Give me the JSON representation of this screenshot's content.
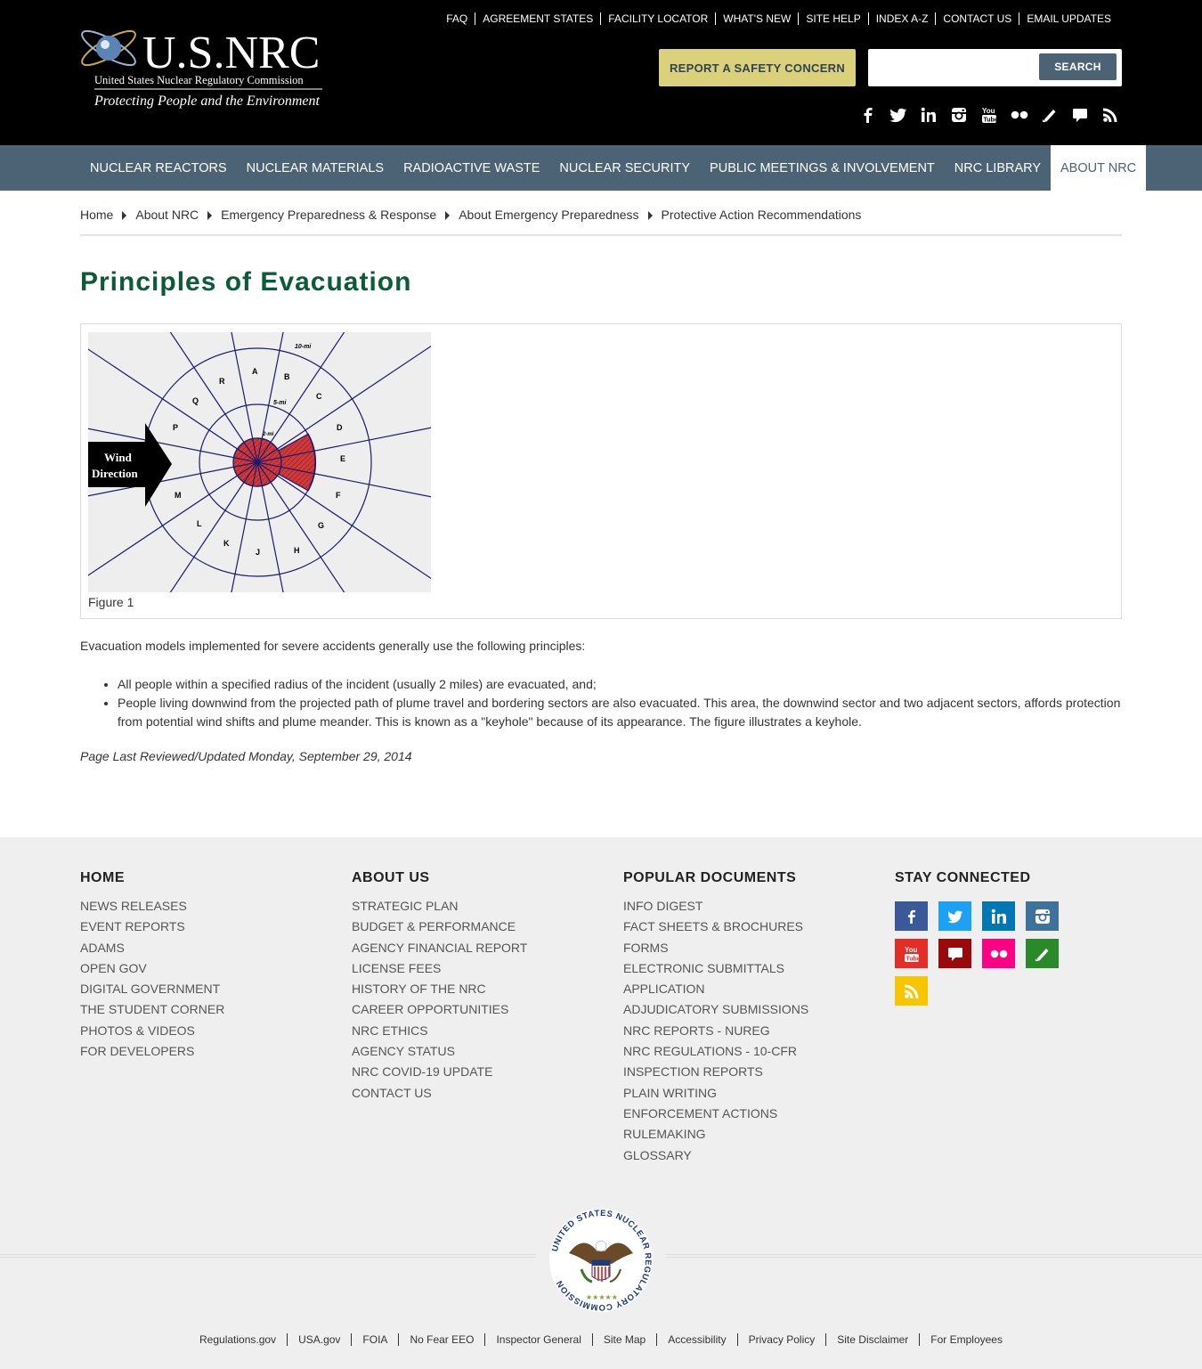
{
  "header": {
    "logo_title": "U.S.NRC",
    "logo_subtitle": "United States Nuclear Regulatory Commission",
    "logo_tagline": "Protecting People and the Environment",
    "utility_links": [
      "FAQ",
      "AGREEMENT STATES",
      "FACILITY LOCATOR",
      "WHAT'S NEW",
      "SITE HELP",
      "INDEX A-Z",
      "CONTACT US",
      "EMAIL UPDATES"
    ],
    "safety_button": "REPORT A SAFETY CONCERN",
    "search_placeholder": "",
    "search_button": "SEARCH",
    "social_icons": [
      "facebook-icon",
      "twitter-icon",
      "linkedin-icon",
      "instagram-icon",
      "youtube-icon",
      "flickr-icon",
      "blog-icon",
      "comment-icon",
      "rss-icon"
    ]
  },
  "nav": {
    "items": [
      "NUCLEAR REACTORS",
      "NUCLEAR MATERIALS",
      "RADIOACTIVE WASTE",
      "NUCLEAR SECURITY",
      "PUBLIC MEETINGS & INVOLVEMENT",
      "NRC LIBRARY",
      "ABOUT NRC"
    ],
    "active": "ABOUT NRC"
  },
  "breadcrumb": [
    "Home",
    "About NRC",
    "Emergency Preparedness & Response",
    "About Emergency Preparedness",
    "Protective Action Recommendations"
  ],
  "page": {
    "title": "Principles of Evacuation",
    "figure": {
      "caption": "Figure 1",
      "wind_label_1": "Wind",
      "wind_label_2": "Direction",
      "ring_labels": [
        "10-mi",
        "5-mi",
        "2-mi"
      ],
      "sectors": [
        "A",
        "B",
        "C",
        "D",
        "E",
        "F",
        "G",
        "H",
        "J",
        "K",
        "L",
        "M",
        "P",
        "Q",
        "R"
      ]
    },
    "intro": "Evacuation models implemented for severe accidents generally use the following principles:",
    "bullets": [
      "All people within a specified radius of the incident (usually 2 miles) are evacuated, and;",
      "People living downwind from the projected path of plume travel and bordering sectors are also evacuated. This area, the downwind sector and two adjacent sectors, affords protection from potential wind shifts and plume meander. This is known as a \"keyhole\" because of its appearance. The figure illustrates a keyhole."
    ],
    "last_updated": "Page Last Reviewed/Updated Monday, September 29, 2014"
  },
  "footer": {
    "home": {
      "heading": "HOME",
      "links": [
        "NEWS RELEASES",
        "EVENT REPORTS",
        "ADAMS",
        "OPEN GOV",
        "DIGITAL GOVERNMENT",
        "THE STUDENT CORNER",
        "PHOTOS & VIDEOS",
        "FOR DEVELOPERS"
      ]
    },
    "about": {
      "heading": "ABOUT US",
      "links": [
        "STRATEGIC PLAN",
        "BUDGET & PERFORMANCE",
        "AGENCY FINANCIAL REPORT",
        "LICENSE FEES",
        "HISTORY OF THE NRC",
        "CAREER OPPORTUNITIES",
        "NRC ETHICS",
        "AGENCY STATUS",
        "NRC COVID-19 UPDATE",
        "CONTACT US"
      ]
    },
    "popular": {
      "heading": "POPULAR DOCUMENTS",
      "links": [
        "INFO DIGEST",
        "FACT SHEETS & BROCHURES",
        "FORMS",
        "ELECTRONIC SUBMITTALS",
        "APPLICATION",
        "ADJUDICATORY SUBMISSIONS",
        "NRC REPORTS - NUREG",
        "NRC REGULATIONS - 10-CFR",
        "INSPECTION REPORTS",
        "PLAIN WRITING",
        "ENFORCEMENT ACTIONS",
        "RULEMAKING",
        "GLOSSARY"
      ]
    },
    "connect": {
      "heading": "STAY CONNECTED",
      "icons": [
        {
          "name": "facebook-icon",
          "color": "#3b5998"
        },
        {
          "name": "twitter-icon",
          "color": "#1da1f2"
        },
        {
          "name": "linkedin-icon",
          "color": "#0077b5"
        },
        {
          "name": "instagram-icon",
          "color": "#3f729b"
        },
        {
          "name": "youtube-icon",
          "color": "#e52d27"
        },
        {
          "name": "comment-icon",
          "color": "#9b0a0a"
        },
        {
          "name": "flickr-icon",
          "color": "#ff0084"
        },
        {
          "name": "blog-icon",
          "color": "#2a8a2a"
        },
        {
          "name": "rss-icon",
          "color": "#f7c600"
        }
      ]
    },
    "seal_text": "UNITED STATES NUCLEAR REGULATORY COMMISSION",
    "bottom_links": [
      "Regulations.gov",
      "USA.gov",
      "FOIA",
      "No Fear EEO",
      "Inspector General",
      "Site Map",
      "Accessibility",
      "Privacy Policy",
      "Site Disclaimer",
      "For Employees"
    ]
  },
  "colors": {
    "header_bg": "#000000",
    "nav_bg": "#4c6275",
    "title_green": "#0d5a3a",
    "safety_yellow": "#dbd17b",
    "keyhole_red": "#d0393b"
  }
}
